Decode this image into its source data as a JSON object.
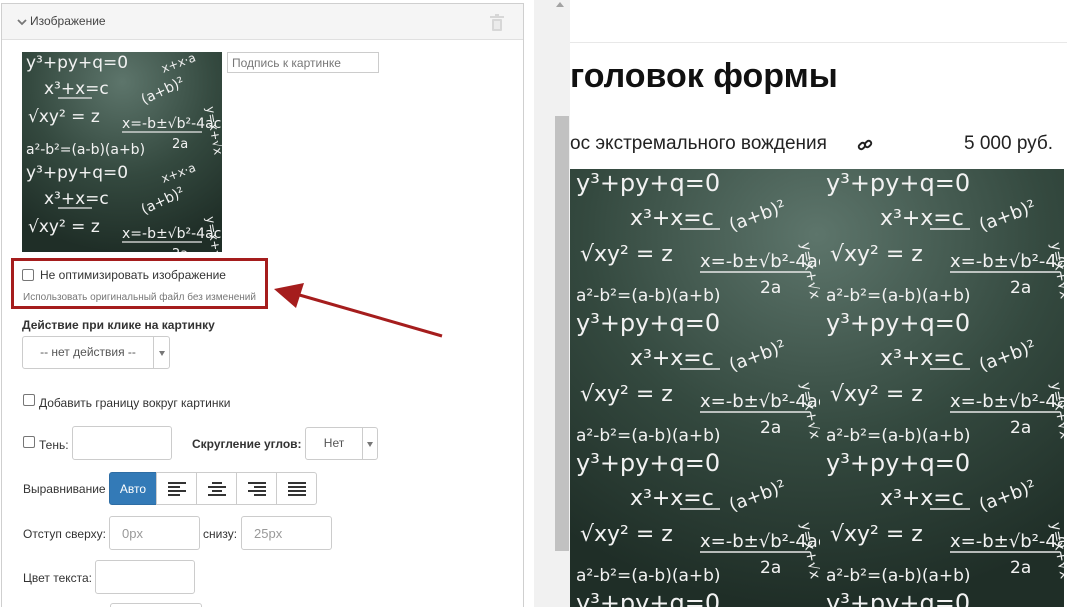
{
  "panel": {
    "title": "Изображение",
    "caption_placeholder": "Подпись к картинке",
    "no_optimize": {
      "label": "Не оптимизировать изображение",
      "hint": "Использовать оригинальный файл без изменений"
    },
    "click_action": {
      "label": "Действие при клике на картинку",
      "value": "-- нет действия --"
    },
    "border_label": "Добавить границу вокруг картинки",
    "shadow_label": "Тень:",
    "radius": {
      "label": "Скругление углов:",
      "value": "Нет"
    },
    "alignment": {
      "label": "Выравнивание",
      "auto_label": "Авто"
    },
    "margin_top": {
      "label": "Отступ сверху:",
      "placeholder": "0px"
    },
    "margin_bottom": {
      "label": "снизу:",
      "placeholder": "25px"
    },
    "text_color_label": "Цвет текста:"
  },
  "preview": {
    "title": "головок формы",
    "product_name": "ос экстремального вождения",
    "price": "5 000 руб."
  },
  "colors": {
    "highlight": "#a51d1d",
    "active_button": "#337ab7",
    "chalkboard": "#2c3f37"
  }
}
